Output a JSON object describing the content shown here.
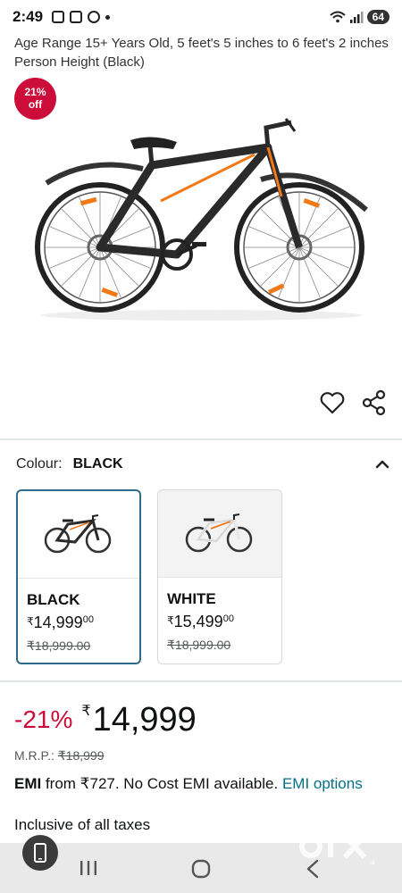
{
  "status_bar": {
    "time": "2:49",
    "battery": "64"
  },
  "product": {
    "title": "Age Range 15+ Years Old, 5 feet's 5 inches to 6 feet's 2 inches Person Height (Black)",
    "discount_badge": {
      "pct": "21%",
      "off": "off"
    }
  },
  "colour": {
    "label": "Colour:",
    "selected": "BLACK",
    "options": [
      {
        "name": "BLACK",
        "symbol": "₹",
        "price_main": "14,999",
        "price_fraction": "00",
        "mrp": "₹18,999.00",
        "selected": true,
        "frame_color": "#2b2b2b"
      },
      {
        "name": "WHITE",
        "symbol": "₹",
        "price_main": "15,499",
        "price_fraction": "00",
        "mrp": "₹18,999.00",
        "selected": false,
        "frame_color": "#f2f2f2"
      }
    ]
  },
  "price": {
    "discount": "-21%",
    "symbol": "₹",
    "amount": "14,999",
    "mrp_label": "M.R.P.:",
    "mrp_value": "₹18,999"
  },
  "emi": {
    "bold": "EMI",
    "text": " from ₹727. No Cost EMI available. ",
    "link": "EMI options"
  },
  "taxes": "Inclusive of all taxes",
  "watermark": "olx",
  "colors": {
    "accent_red": "#cc0c39",
    "link": "#007185",
    "selected_border": "#2d6a8f",
    "bike_orange": "#f07a1a"
  }
}
